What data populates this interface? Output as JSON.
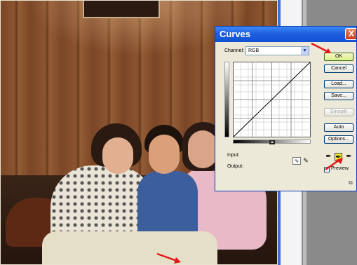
{
  "dialog": {
    "title": "Curves",
    "close_glyph": "X",
    "channel_label": "Channel:",
    "channel_value": "RGB",
    "input_label": "Input:",
    "output_label": "Output:",
    "buttons": {
      "ok": "OK",
      "cancel": "Cancel",
      "load": "Load...",
      "save": "Save...",
      "smooth": "Smooth",
      "auto": "Auto",
      "options": "Options..."
    },
    "preview_label": "Preview",
    "preview_checked": true,
    "selected_eyedropper": "gray-point"
  },
  "icons": {
    "close": "close-icon",
    "select_arrow": "chevron-down-icon",
    "curve_tool": "curve-tool-icon",
    "pencil_tool": "pencil-icon",
    "black_eyedropper": "black-eyedropper-icon",
    "gray_eyedropper": "gray-eyedropper-icon",
    "white_eyedropper": "white-eyedropper-icon"
  },
  "colors": {
    "titlebar": "#1e5fe0",
    "dialog_bg": "#ece9d8",
    "annotation_arrow": "#e01818",
    "ok_highlight": "#dcee8a",
    "eyedropper_selected": "#f2ee32"
  }
}
